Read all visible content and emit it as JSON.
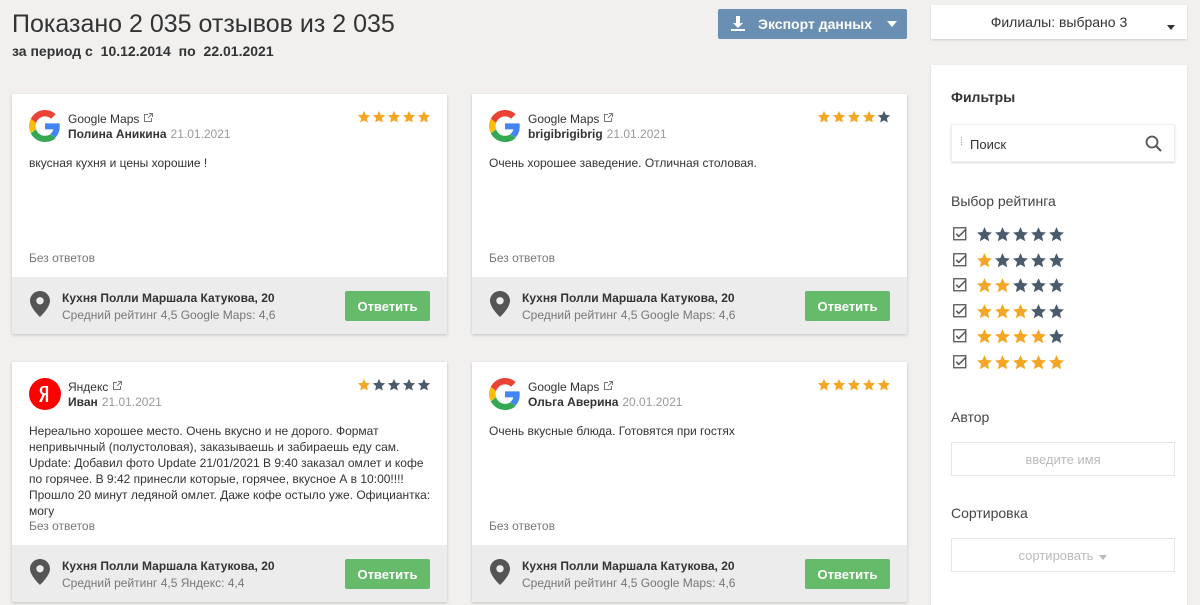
{
  "header": {
    "title": "Показано 2 035 отзывов из 2 035",
    "period_prefix": "за период с",
    "date_from": "10.12.2014",
    "period_to": "по",
    "date_to": "22.01.2021"
  },
  "toolbar": {
    "export_label": "Экспорт данных",
    "branches_label": "Филиалы: выбрано 3"
  },
  "colors": {
    "star_filled": "#f5a623",
    "star_empty": "#4a5b6c",
    "accent": "#6b8fb3",
    "reply_green": "#66bb6a"
  },
  "reviews": [
    {
      "source": "Google Maps",
      "source_icon": "google-logo",
      "author": "Полина Аникина",
      "date": "21.01.2021",
      "rating": 5,
      "text": "вкусная кухня и цены хорошие !",
      "reply_status": "Без ответов",
      "location": "Кухня Полли Маршала Катукова, 20",
      "avg_rating": "Средний рейтинг 4,5 Google Maps: 4,6",
      "reply_label": "Ответить"
    },
    {
      "source": "Google Maps",
      "source_icon": "google-logo",
      "author": "brigibrigibrig",
      "date": "21.01.2021",
      "rating": 4,
      "text": "Очень хорошее заведение. Отличная столовая.",
      "reply_status": "Без ответов",
      "location": "Кухня Полли Маршала Катукова, 20",
      "avg_rating": "Средний рейтинг 4,5 Google Maps: 4,6",
      "reply_label": "Ответить"
    },
    {
      "source": "Яндекс",
      "source_icon": "yandex-logo",
      "author": "Иван",
      "date": "21.01.2021",
      "rating": 1,
      "text": "Нереально хорошее место. Очень вкусно и не дорого. Формат непривычный (полустоловая), заказываешь и забираешь еду сам. Update: Добавил фото Update 21/01/2021 В 9:40 заказал омлет и кофе по горячее. В 9:42 принесли которые, горячее, вкусное А в 10:00!!!! Прошло 20 минут ледяной омлет. Даже кофе остыло уже. Официантка: могу",
      "reply_status": "Без ответов",
      "location": "Кухня Полли Маршала Катукова, 20",
      "avg_rating": "Средний рейтинг 4,5 Яндекс: 4,4",
      "reply_label": "Ответить"
    },
    {
      "source": "Google Maps",
      "source_icon": "google-logo",
      "author": "Ольга Аверина",
      "date": "20.01.2021",
      "rating": 5,
      "text": "Очень вкусные блюда. Готовятся при гостях",
      "reply_status": "Без ответов",
      "location": "Кухня Полли Маршала Катукова, 20",
      "avg_rating": "Средний рейтинг 4,5 Google Maps: 4,6",
      "reply_label": "Ответить"
    }
  ],
  "filters": {
    "title": "Фильтры",
    "search_placeholder": "Поиск",
    "rating_label": "Выбор рейтинга",
    "rating_options": [
      {
        "filled": 0,
        "checked": true
      },
      {
        "filled": 1,
        "checked": true
      },
      {
        "filled": 2,
        "checked": true
      },
      {
        "filled": 3,
        "checked": true
      },
      {
        "filled": 4,
        "checked": true
      },
      {
        "filled": 5,
        "checked": true
      }
    ],
    "author_label": "Автор",
    "author_placeholder": "введите имя",
    "sort_label": "Сортировка",
    "sort_value": "сортировать"
  }
}
